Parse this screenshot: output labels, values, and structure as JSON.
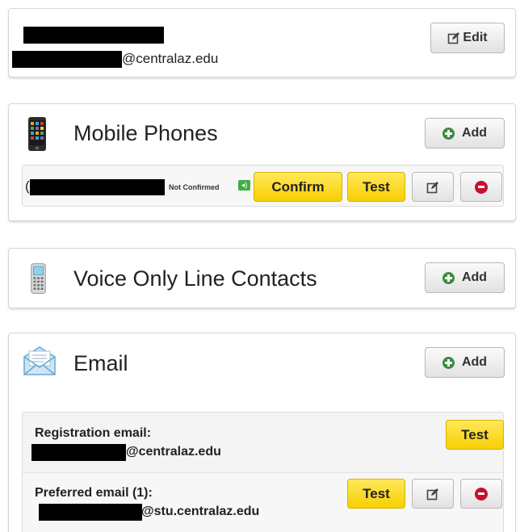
{
  "profile": {
    "email_domain": "@centralaz.edu",
    "edit_label": "Edit"
  },
  "mobile": {
    "title": "Mobile Phones",
    "add_label": "Add",
    "entry": {
      "prefix": "(",
      "status": "Not Confirmed",
      "confirm_label": "Confirm",
      "test_label": "Test"
    }
  },
  "voice": {
    "title": "Voice Only Line Contacts",
    "add_label": "Add"
  },
  "email": {
    "title": "Email",
    "add_label": "Add",
    "registration": {
      "label": "Registration email:",
      "domain": "@centralaz.edu",
      "test_label": "Test"
    },
    "preferred": {
      "label": "Preferred email (1):",
      "domain": "@stu.centralaz.edu",
      "test_label": "Test"
    }
  },
  "colors": {
    "yellow_button": "#f7cf00",
    "add_icon": "#3d8b3d",
    "delete_icon": "#c8102e",
    "speaker_badge": "#3fae3f"
  }
}
